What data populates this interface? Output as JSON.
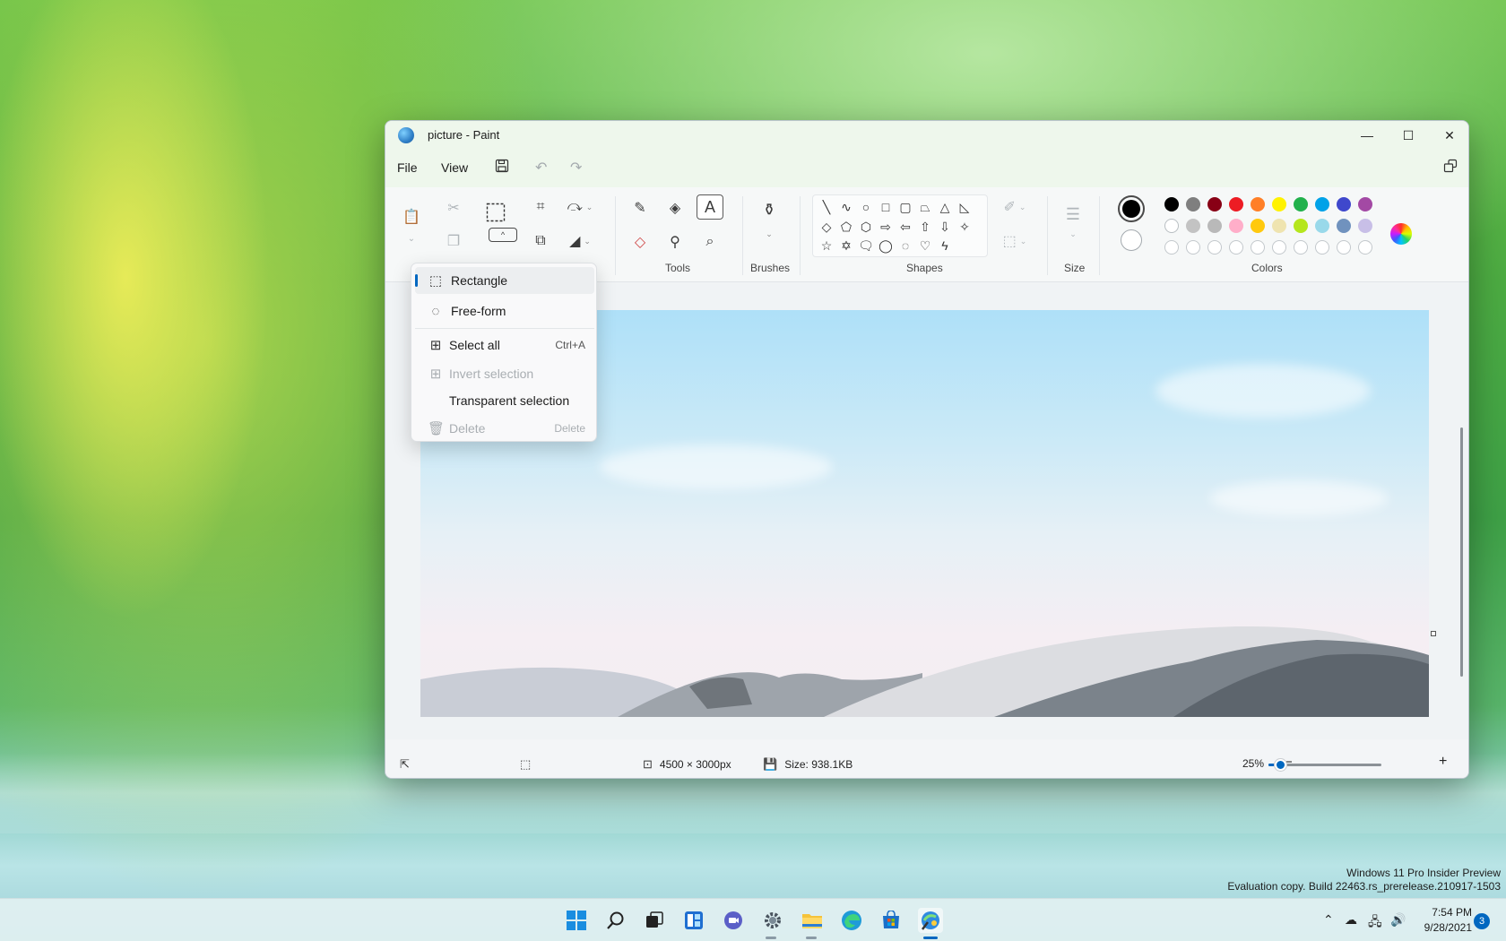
{
  "window": {
    "title": "picture - Paint",
    "controls": {
      "minimize": "—",
      "maximize": "☐",
      "close": "✕"
    }
  },
  "menubar": {
    "file": "File",
    "view": "View",
    "save_icon": "save-icon",
    "undo_icon": "undo-icon",
    "redo_icon": "redo-icon",
    "settings_icon": "share-icon"
  },
  "ribbon": {
    "groups": {
      "tools": "Tools",
      "brushes": "Brushes",
      "shapes": "Shapes",
      "size": "Size",
      "colors": "Colors"
    },
    "current_colors": {
      "primary": "#000000",
      "secondary": "#ffffff"
    },
    "palette_row1": [
      "#000000",
      "#7f7f7f",
      "#880015",
      "#ed1c24",
      "#ff7f27",
      "#fff200",
      "#22b14c",
      "#00a2e8",
      "#3f48cc",
      "#a349a4"
    ],
    "palette_row2": [
      "#ffffff",
      "#c3c3c3",
      "#b9b9b9",
      "#ffaec9",
      "#ffc90e",
      "#efe4b0",
      "#b5e61d",
      "#99d9ea",
      "#7092be",
      "#c8bfe7"
    ],
    "palette_row3_empty": 10
  },
  "select_menu": {
    "items": [
      {
        "label": "Rectangle",
        "icon": "rectangle-select-icon",
        "shortcut": "",
        "active": true,
        "disabled": false
      },
      {
        "label": "Free-form",
        "icon": "freeform-select-icon",
        "shortcut": "",
        "active": false,
        "disabled": false
      },
      {
        "label": "Select all",
        "icon": "select-all-icon",
        "shortcut": "Ctrl+A",
        "active": false,
        "disabled": false
      },
      {
        "label": "Invert selection",
        "icon": "invert-selection-icon",
        "shortcut": "",
        "active": false,
        "disabled": true
      },
      {
        "label": "Transparent selection",
        "icon": "",
        "shortcut": "",
        "active": false,
        "disabled": false
      },
      {
        "label": "Delete",
        "icon": "delete-icon",
        "shortcut": "Delete",
        "active": false,
        "disabled": true
      }
    ]
  },
  "statusbar": {
    "dimensions": "4500 × 3000px",
    "size": "Size: 938.1KB",
    "zoom": "25%",
    "zoom_level_fraction": 0.1
  },
  "watermark": {
    "line1": "Windows 11 Pro Insider Preview",
    "line2": "Evaluation copy. Build 22463.rs_prerelease.210917-1503"
  },
  "taskbar": {
    "time": "7:54 PM",
    "date": "9/28/2021",
    "notifications": "3"
  }
}
